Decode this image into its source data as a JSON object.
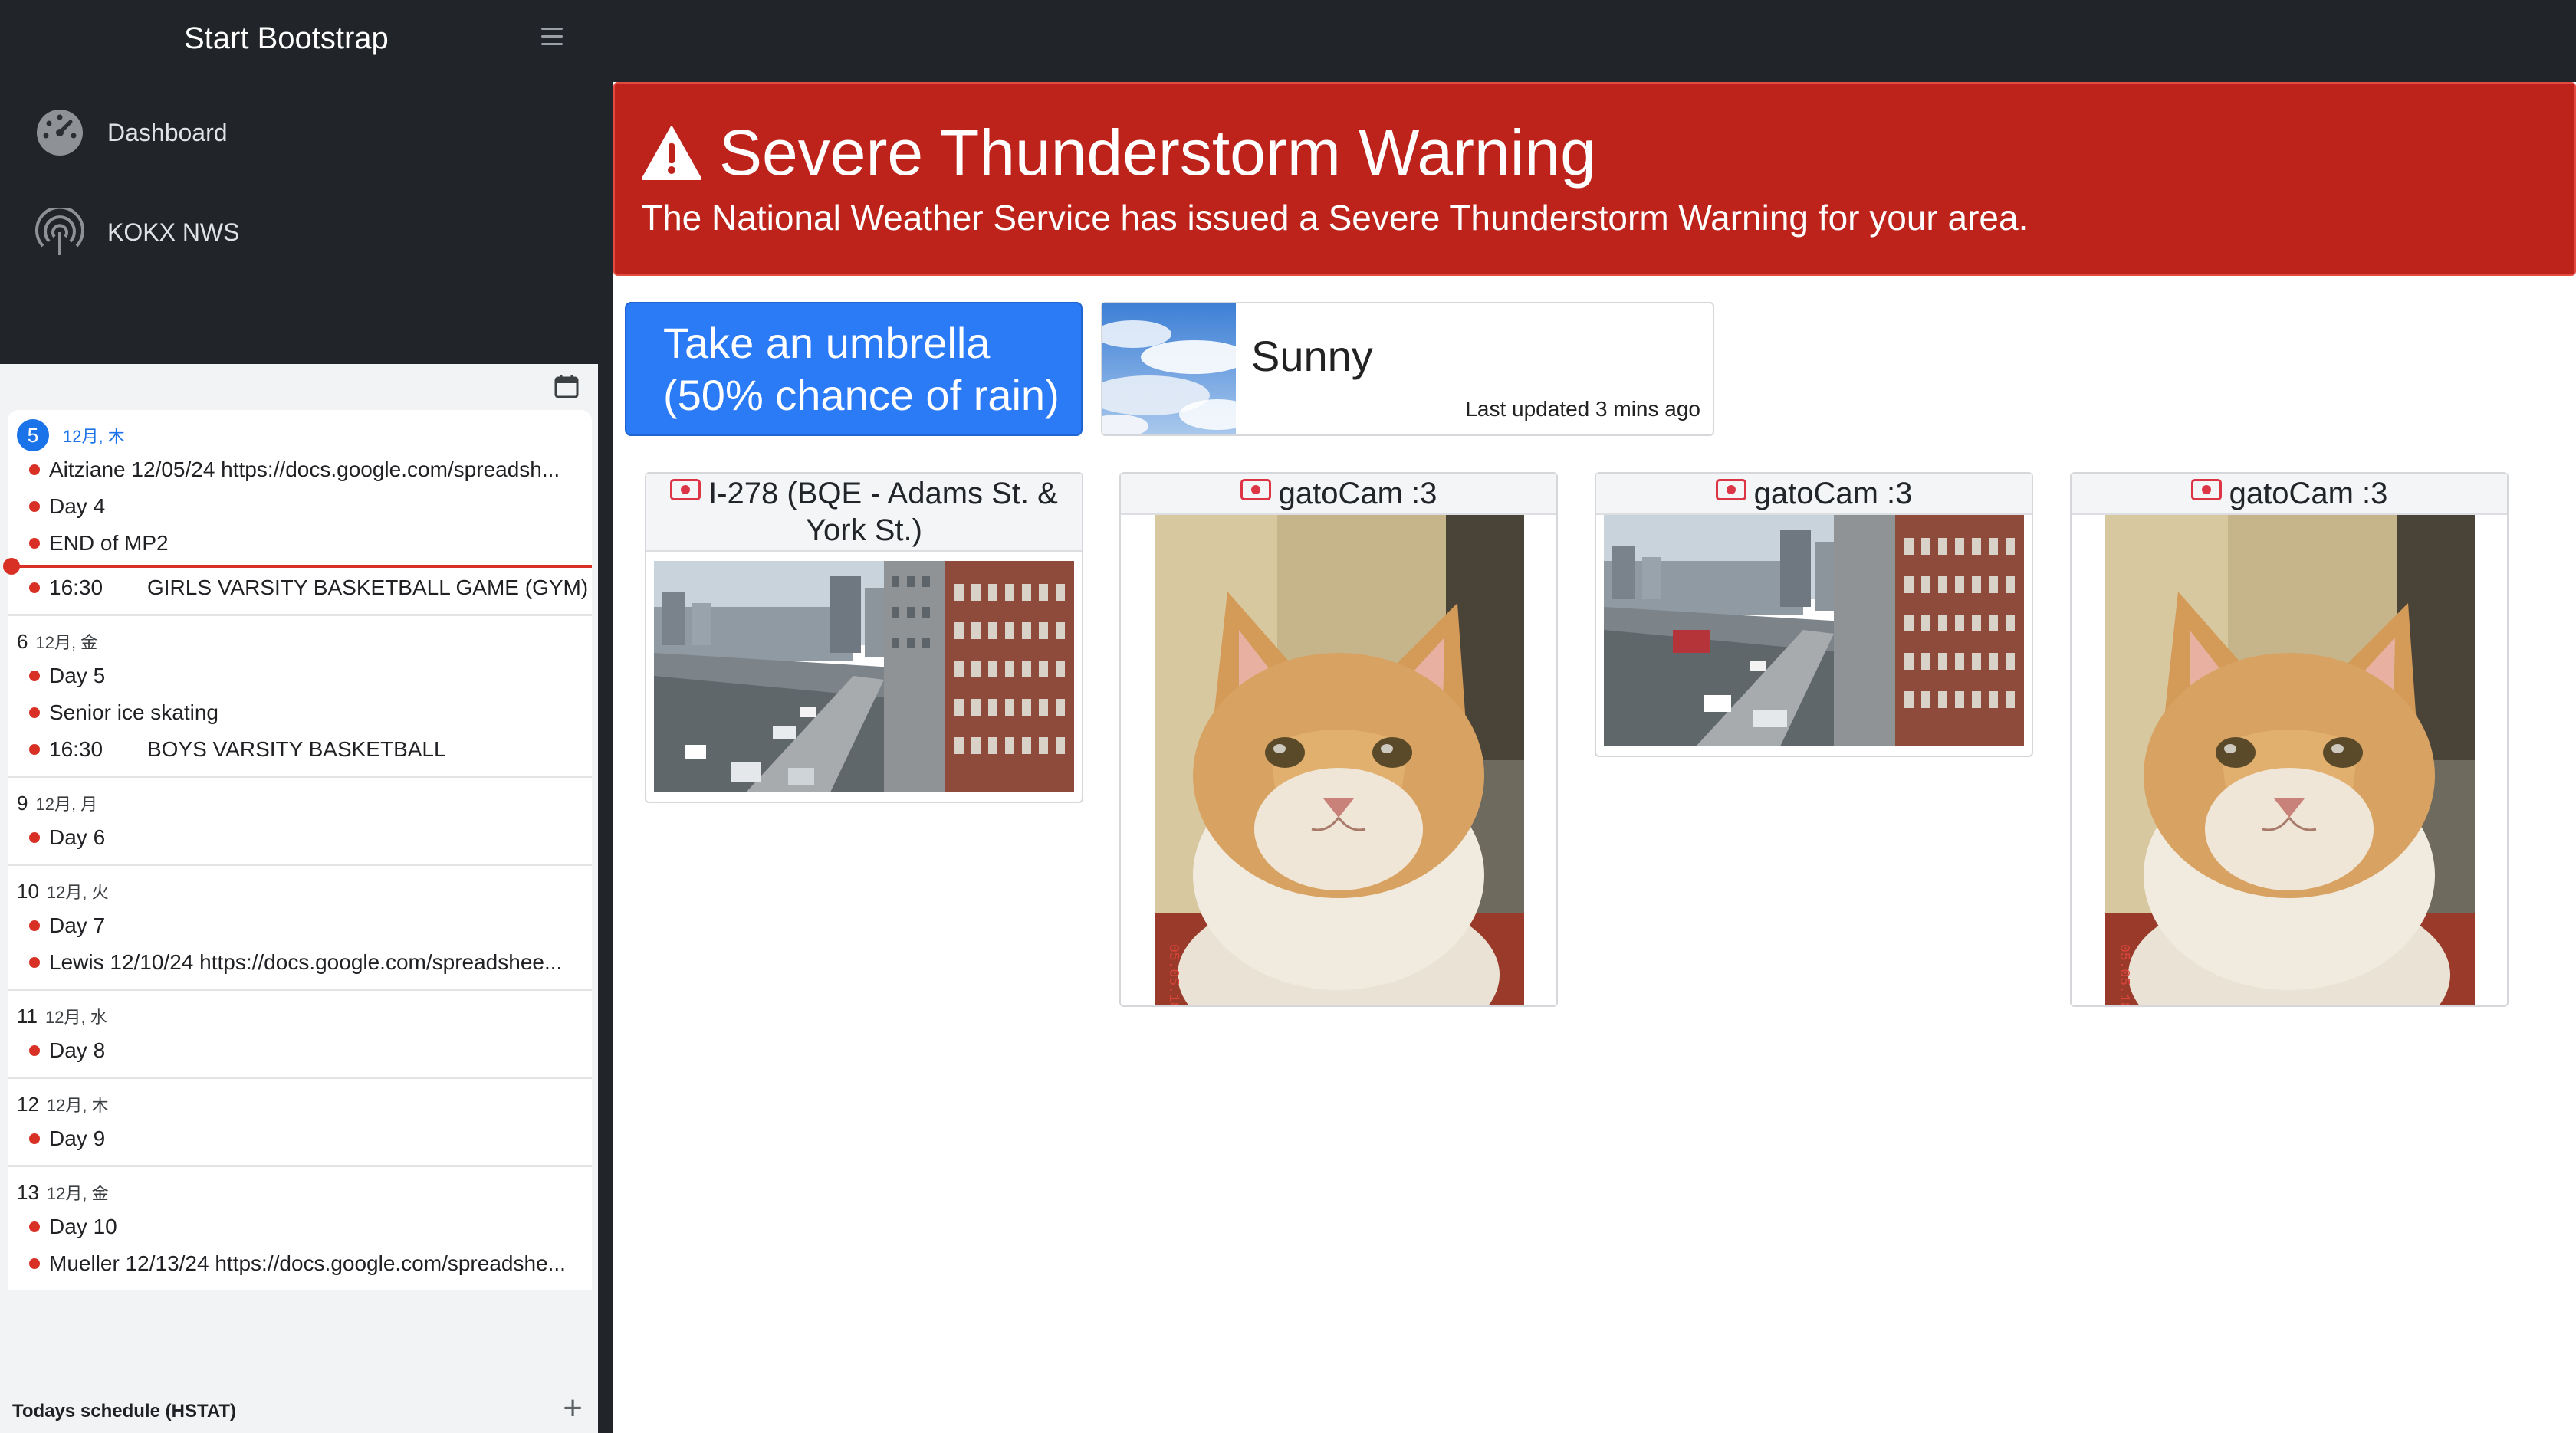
{
  "nav": {
    "brand": "Start Bootstrap"
  },
  "sidebar": {
    "items": [
      {
        "label": "Dashboard",
        "icon": "speedometer-icon"
      },
      {
        "label": "KOKX NWS",
        "icon": "broadcast-icon"
      }
    ]
  },
  "calendar": {
    "days": [
      {
        "num": "5",
        "date": "12月, 木",
        "today": true,
        "events": [
          {
            "time": "",
            "text": "Aitziane 12/05/24 https://docs.google.com/spreadsh..."
          },
          {
            "time": "",
            "text": "Day 4"
          },
          {
            "time": "",
            "text": "END of MP2"
          },
          {
            "time": "16:30",
            "text": "GIRLS VARSITY BASKETBALL GAME (GYM)"
          }
        ]
      },
      {
        "num": "6",
        "date": "12月, 金",
        "events": [
          {
            "time": "",
            "text": "Day 5"
          },
          {
            "time": "",
            "text": "Senior ice skating"
          },
          {
            "time": "16:30",
            "text": "BOYS VARSITY BASKETBALL"
          }
        ]
      },
      {
        "num": "9",
        "date": "12月, 月",
        "events": [
          {
            "time": "",
            "text": "Day 6"
          }
        ]
      },
      {
        "num": "10",
        "date": "12月, 火",
        "events": [
          {
            "time": "",
            "text": "Day 7"
          },
          {
            "time": "",
            "text": "Lewis 12/10/24 https://docs.google.com/spreadshee..."
          }
        ]
      },
      {
        "num": "11",
        "date": "12月, 水",
        "events": [
          {
            "time": "",
            "text": "Day 8"
          }
        ]
      },
      {
        "num": "12",
        "date": "12月, 木",
        "events": [
          {
            "time": "",
            "text": "Day 9"
          }
        ]
      },
      {
        "num": "13",
        "date": "12月, 金",
        "events": [
          {
            "time": "",
            "text": "Day 10"
          },
          {
            "time": "",
            "text": "Mueller 12/13/24 https://docs.google.com/spreadshe..."
          }
        ]
      }
    ],
    "footer_title": "Todays schedule (HSTAT)",
    "add_symbol": "+"
  },
  "alert": {
    "title": "Severe Thunderstorm Warning",
    "message": "The National Weather Service has issued a Severe Thunderstorm Warning for your area.",
    "color": "#bd231b"
  },
  "tip": {
    "line1": "Take an umbrella",
    "line2": "(50% chance of rain)",
    "color": "#2b7bf6"
  },
  "weather": {
    "condition": "Sunny",
    "updated": "Last updated 3 mins ago"
  },
  "cams": [
    {
      "title": "I-278 (BQE - Adams St. & York St.)",
      "kind": "traffic"
    },
    {
      "title": "gatoCam :3",
      "kind": "cat"
    },
    {
      "title": "gatoCam :3",
      "kind": "traffic"
    },
    {
      "title": "gatoCam :3",
      "kind": "cat"
    }
  ]
}
